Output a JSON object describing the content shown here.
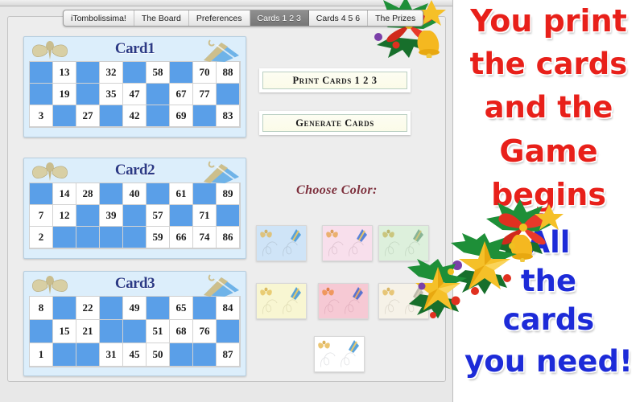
{
  "window": {
    "tabs": [
      {
        "label": "iTombolissima!",
        "active": false
      },
      {
        "label": "The Board",
        "active": false
      },
      {
        "label": "Preferences",
        "active": false
      },
      {
        "label": "Cards 1 2 3",
        "active": true
      },
      {
        "label": "Cards 4 5 6",
        "active": false
      },
      {
        "label": "The Prizes",
        "active": false
      }
    ]
  },
  "cards": [
    {
      "title": "Card1",
      "rows": [
        [
          "",
          "13",
          "",
          "32",
          "",
          "58",
          "",
          "70",
          "88"
        ],
        [
          "",
          "19",
          "",
          "35",
          "47",
          "",
          "67",
          "77",
          ""
        ],
        [
          "3",
          "",
          "27",
          "",
          "42",
          "",
          "69",
          "",
          "83"
        ]
      ]
    },
    {
      "title": "Card2",
      "rows": [
        [
          "",
          "14",
          "28",
          "",
          "40",
          "",
          "61",
          "",
          "89"
        ],
        [
          "7",
          "12",
          "",
          "39",
          "",
          "57",
          "",
          "71",
          ""
        ],
        [
          "2",
          "",
          "",
          "",
          "",
          "59",
          "66",
          "74",
          "86"
        ]
      ]
    },
    {
      "title": "Card3",
      "rows": [
        [
          "8",
          "",
          "22",
          "",
          "49",
          "",
          "65",
          "",
          "84"
        ],
        [
          "",
          "15",
          "21",
          "",
          "",
          "51",
          "68",
          "76",
          ""
        ],
        [
          "1",
          "",
          "",
          "31",
          "45",
          "50",
          "",
          "",
          "87"
        ]
      ]
    }
  ],
  "buttons": {
    "print_label": "Print Cards 1 2 3",
    "generate_label": "Generate Cards"
  },
  "color_chooser": {
    "label": "Choose Color:",
    "swatches": [
      {
        "name": "blue",
        "hex": "#cfe4f7"
      },
      {
        "name": "pink",
        "hex": "#f8dfec"
      },
      {
        "name": "green",
        "hex": "#ddf0dc"
      },
      {
        "name": "yellow",
        "hex": "#f8f6d2"
      },
      {
        "name": "rose",
        "hex": "#f6c9d4"
      },
      {
        "name": "ivory",
        "hex": "#f6f2e8"
      },
      {
        "name": "white",
        "hex": "#ffffff"
      }
    ]
  },
  "promo": {
    "lines": [
      {
        "text": "You print",
        "color": "red"
      },
      {
        "text": "the cards",
        "color": "red"
      },
      {
        "text": "and the",
        "color": "red"
      },
      {
        "text": "Game",
        "color": "red"
      },
      {
        "text": "begins",
        "color": "red"
      },
      {
        "text": "All",
        "color": "blue"
      },
      {
        "text": "the",
        "color": "blue"
      },
      {
        "text": "cards",
        "color": "blue"
      },
      {
        "text": "you need!",
        "color": "blue"
      }
    ]
  },
  "colors": {
    "cell_filled": "#5a9fe8",
    "card_background": "#dceefb",
    "card_title": "#2b3a85",
    "promo_red": "#e8201a",
    "promo_blue": "#1d2bd8",
    "choose_color_text": "#7d2f3c"
  }
}
